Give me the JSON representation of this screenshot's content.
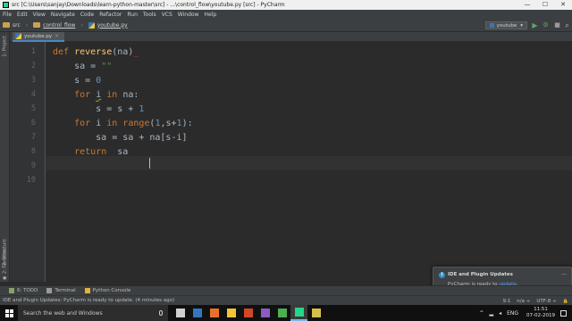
{
  "window": {
    "title": "src [C:\\Users\\sanjay\\Downloads\\learn-python-master\\src] - ...\\control_flow\\youtube.py [src] - PyCharm",
    "min": "—",
    "max": "☐",
    "close": "✕"
  },
  "menu": [
    "File",
    "Edit",
    "View",
    "Navigate",
    "Code",
    "Refactor",
    "Run",
    "Tools",
    "VCS",
    "Window",
    "Help"
  ],
  "nav": {
    "crumbs": [
      "src",
      "control_flow",
      "youtube.py"
    ],
    "run_config": "youtube",
    "run_icon": "▶",
    "debug_icon": "⚙",
    "search_icon": "⌕"
  },
  "left_tabs": {
    "project": "1: Project",
    "structure": "2: Structure",
    "favorites": "2: Favorites"
  },
  "editor_tab": {
    "filename": "youtube.py",
    "close": "×"
  },
  "editor": {
    "line_numbers": [
      "1",
      "2",
      "3",
      "4",
      "5",
      "6",
      "7",
      "8",
      "9",
      "10"
    ],
    "lines": [
      [
        {
          "t": "def ",
          "c": "kw"
        },
        {
          "t": "reverse",
          "c": "fn"
        },
        {
          "t": "(na)",
          "c": ""
        },
        {
          "t": "_",
          "c": "errchar"
        }
      ],
      [
        {
          "t": "    sa = ",
          "c": ""
        },
        {
          "t": "\"\"",
          "c": "str"
        }
      ],
      [
        {
          "t": "    s = ",
          "c": ""
        },
        {
          "t": "0",
          "c": "num"
        }
      ],
      [
        {
          "t": "    ",
          "c": ""
        },
        {
          "t": "for ",
          "c": "kw"
        },
        {
          "t": "i",
          "c": "warn"
        },
        {
          "t": " ",
          "c": ""
        },
        {
          "t": "in ",
          "c": "kw"
        },
        {
          "t": "na:",
          "c": ""
        }
      ],
      [
        {
          "t": "        s = s + ",
          "c": ""
        },
        {
          "t": "1",
          "c": "num"
        }
      ],
      [
        {
          "t": "    ",
          "c": ""
        },
        {
          "t": "for ",
          "c": "kw"
        },
        {
          "t": "i ",
          "c": ""
        },
        {
          "t": "in ",
          "c": "kw"
        },
        {
          "t": "range",
          "c": "kw"
        },
        {
          "t": "(",
          "c": ""
        },
        {
          "t": "1",
          "c": "num"
        },
        {
          "t": ",s+",
          "c": ""
        },
        {
          "t": "1",
          "c": "num"
        },
        {
          "t": "):",
          "c": ""
        }
      ],
      [
        {
          "t": "        sa = sa + na[s-i]",
          "c": ""
        }
      ],
      [
        {
          "t": "    ",
          "c": ""
        },
        {
          "t": "return  ",
          "c": "kw"
        },
        {
          "t": "sa",
          "c": ""
        }
      ],
      [
        {
          "t": "",
          "c": ""
        }
      ],
      [
        {
          "t": "",
          "c": ""
        }
      ]
    ]
  },
  "notification": {
    "title": "IDE and Plugin Updates",
    "body": "PyCharm is ready to ",
    "link": "update",
    "body_end": ".",
    "close": "—"
  },
  "bottom_tools": [
    {
      "label": "6: TODO",
      "icon": "todo-icon",
      "color": "#8aa26a"
    },
    {
      "label": "Terminal",
      "icon": "terminal-icon",
      "color": "#9a9a9a"
    },
    {
      "label": "Python Console",
      "icon": "python-console-icon",
      "color": "#e0b33a"
    }
  ],
  "status": {
    "message": "IDE and Plugin Updates: PyCharm is ready to update. (4 minutes ago)",
    "position": "9:1",
    "line_sep": "n/a ÷",
    "encoding": "UTF-8 ÷",
    "lock_icon": "🔒"
  },
  "taskbar": {
    "search_placeholder": "Search the web and Windows",
    "apps": [
      {
        "name": "task-view",
        "color": "#d0d0d0"
      },
      {
        "name": "edge",
        "color": "#3277bc"
      },
      {
        "name": "firefox",
        "color": "#e8712a"
      },
      {
        "name": "file-explorer",
        "color": "#f0c33a"
      },
      {
        "name": "office",
        "color": "#d24726"
      },
      {
        "name": "visual-studio",
        "color": "#8a5cc4"
      },
      {
        "name": "chrome",
        "color": "#4caf50"
      },
      {
        "name": "pycharm",
        "color": "#21d789"
      },
      {
        "name": "app-yellow",
        "color": "#d6c04a"
      }
    ],
    "tray_chevron": "^",
    "language": "ENG",
    "time": "11:51",
    "date": "07-02-2019"
  }
}
